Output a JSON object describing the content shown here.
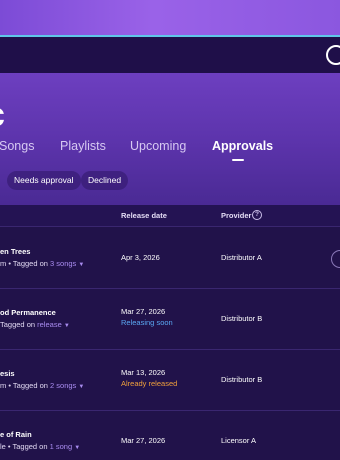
{
  "colors": {
    "accent": "#a98cf0",
    "status_soon": "#5aa7f2",
    "status_released": "#f0a03c",
    "hero": "#5b33aa",
    "background": "#21124a"
  },
  "header": {
    "search_icon": "search-icon"
  },
  "page": {
    "title": "c"
  },
  "tabs": [
    {
      "label": "Songs",
      "active": false
    },
    {
      "label": "Playlists",
      "active": false
    },
    {
      "label": "Upcoming",
      "active": false
    },
    {
      "label": "Approvals",
      "active": true
    }
  ],
  "filters": [
    {
      "label": "Needs approval"
    },
    {
      "label": "Declined"
    }
  ],
  "table": {
    "columns": {
      "release_date": "Release date",
      "provider": "Provider",
      "provider_info_icon": "?"
    },
    "rows": [
      {
        "title": "en Trees",
        "sub_prefix": "m • Tagged on",
        "sub_link": "3 songs",
        "date": "Apr 3, 2026",
        "status": "",
        "provider": "Distributor A"
      },
      {
        "title": "od Permanence",
        "sub_prefix": "Tagged on",
        "sub_link": "release",
        "date": "Mar 27, 2026",
        "status": "Releasing soon",
        "provider": "Distributor B"
      },
      {
        "title": "esis",
        "sub_prefix": "m • Tagged on",
        "sub_link": "2 songs",
        "date": "Mar 13, 2026",
        "status": "Already released",
        "provider": "Distributor B"
      },
      {
        "title": "e of Rain",
        "sub_prefix": "le • Tagged on",
        "sub_link": "1 song",
        "date": "Mar 27, 2026",
        "status": "",
        "provider": "Licensor A"
      }
    ]
  }
}
